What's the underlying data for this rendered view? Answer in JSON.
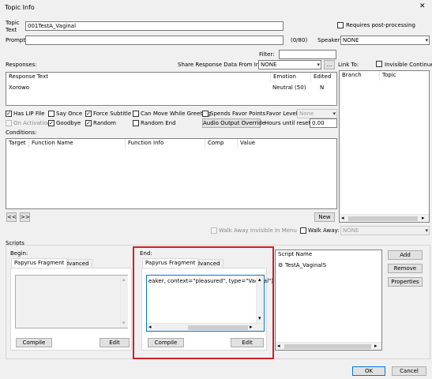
{
  "window_title": "Topic Info",
  "close_glyph": "✕",
  "topic_text": {
    "label": "Topic Text",
    "value": "001TestA_Vaginal"
  },
  "requires_post": {
    "label": "Requires post-processing"
  },
  "prompt": {
    "label": "Prompt:",
    "value": "",
    "count": "(0/80)"
  },
  "speaker": {
    "label": "Speaker:",
    "value": "NONE"
  },
  "filter": {
    "label": "Filter:",
    "value": ""
  },
  "responses": {
    "label": "Responses:",
    "share_label": "Share Response Data From Info:",
    "share_value": "NONE",
    "dots": "...",
    "columns": [
      "Response Text",
      "Emotion",
      "Edited"
    ],
    "rows": [
      {
        "text": "Xorowo",
        "emotion": "Neutral (50)",
        "edited": "N"
      }
    ]
  },
  "link_to": {
    "label": "Link To:",
    "invisible_continue": "Invisible Continue",
    "columns": [
      "Branch",
      "Topic"
    ]
  },
  "options": {
    "has_lip": "Has LIP File",
    "say_once": "Say Once",
    "force_subtitle": "Force Subtitle",
    "can_move": "Can Move While Greeting",
    "spends_favor": "Spends Favor Points",
    "favor_label": "Favor Level:",
    "favor_value": "None",
    "on_activation": "On Activation",
    "goodbye": "Goodbye",
    "random": "Random",
    "random_end": "Random End",
    "audio_override": "Audio Output Override",
    "hours_label": "Hours until reset:",
    "hours_value": "0.00"
  },
  "conditions": {
    "label": "Conditions:",
    "columns": [
      "Target",
      "Function Name",
      "Function Info",
      "Comp",
      "Value"
    ],
    "prev": "<<",
    "next": ">>",
    "new": "New"
  },
  "walk_away_invisible": "Walk Away Invisible In Menu",
  "walk_away": {
    "label": "Walk Away:",
    "value": "NONE"
  },
  "scripts": {
    "label": "Scripts",
    "begin": {
      "label": "Begin:",
      "tab_fragment": "Papyrus Fragment",
      "tab_advanced": "Advanced",
      "compile": "Compile",
      "edit": "Edit"
    },
    "end": {
      "label": "End:",
      "tab_fragment": "Papyrus Fragment",
      "tab_advanced": "Advanced",
      "code": "eaker, context=\"pleasured\", type=\"Vaginal\")",
      "compile": "Compile",
      "edit": "Edit"
    },
    "list": {
      "header": "Script Name",
      "items": [
        "TestA_VaginalS"
      ]
    },
    "add": "Add",
    "remove": "Remove",
    "properties": "Properties"
  },
  "ok": "OK",
  "cancel": "Cancel",
  "colors": {
    "highlight": "#c8232c",
    "accent": "#0078d7"
  }
}
